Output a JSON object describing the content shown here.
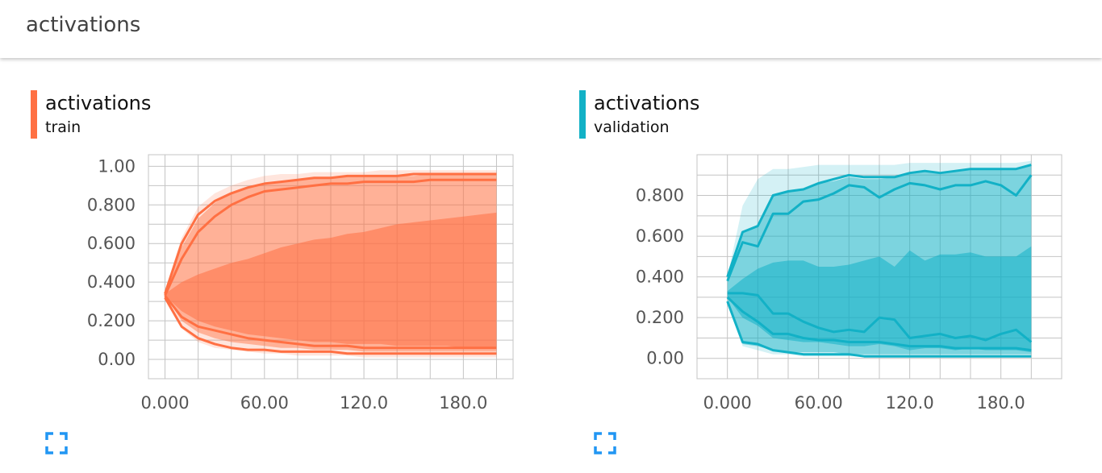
{
  "header": {
    "title": "activations"
  },
  "colors": {
    "train": "#ff7043",
    "validation": "#12b1c6"
  },
  "cards": [
    {
      "title": "activations",
      "subtitle": "train",
      "color": "#ff7043",
      "expand_icon": "fullscreen-icon",
      "chart_data": {
        "type": "area",
        "title": "activations",
        "subtitle": "train",
        "xlim": [
          -10,
          210
        ],
        "ylim": [
          -0.1,
          1.06
        ],
        "xticks": [
          0,
          60,
          120,
          180
        ],
        "xtick_labels": [
          "0.000",
          "60.00",
          "120.0",
          "180.0"
        ],
        "yticks": [
          0,
          0.2,
          0.4,
          0.6,
          0.8,
          1.0
        ],
        "ytick_labels": [
          "0.00",
          "0.200",
          "0.400",
          "0.600",
          "0.800",
          "1.00"
        ],
        "grid": true,
        "x": [
          0,
          10,
          20,
          30,
          40,
          50,
          60,
          70,
          80,
          90,
          100,
          110,
          120,
          130,
          140,
          150,
          160,
          170,
          180,
          190,
          200
        ],
        "bands": [
          {
            "name": "outer",
            "lower": [
              0.33,
              0.16,
              0.09,
              0.06,
              0.05,
              0.04,
              0.03,
              0.03,
              0.02,
              0.02,
              0.02,
              0.02,
              0.01,
              0.01,
              0.01,
              0.01,
              0.01,
              0.01,
              0.01,
              0.01,
              0.01
            ],
            "upper": [
              0.36,
              0.63,
              0.79,
              0.86,
              0.9,
              0.93,
              0.95,
              0.96,
              0.96,
              0.97,
              0.97,
              0.97,
              0.97,
              0.98,
              0.98,
              0.98,
              0.98,
              0.98,
              0.98,
              0.98,
              0.98
            ]
          },
          {
            "name": "mid",
            "lower": [
              0.33,
              0.2,
              0.14,
              0.11,
              0.09,
              0.08,
              0.07,
              0.06,
              0.06,
              0.05,
              0.05,
              0.05,
              0.04,
              0.04,
              0.04,
              0.04,
              0.04,
              0.04,
              0.04,
              0.04,
              0.04
            ],
            "upper": [
              0.35,
              0.58,
              0.73,
              0.81,
              0.86,
              0.89,
              0.91,
              0.92,
              0.93,
              0.94,
              0.94,
              0.95,
              0.95,
              0.95,
              0.95,
              0.95,
              0.96,
              0.96,
              0.96,
              0.96,
              0.96
            ]
          },
          {
            "name": "inner",
            "lower": [
              0.33,
              0.25,
              0.2,
              0.17,
              0.15,
              0.13,
              0.12,
              0.11,
              0.1,
              0.09,
              0.09,
              0.08,
              0.08,
              0.08,
              0.07,
              0.07,
              0.07,
              0.07,
              0.06,
              0.06,
              0.06
            ],
            "upper": [
              0.34,
              0.4,
              0.44,
              0.47,
              0.5,
              0.52,
              0.55,
              0.58,
              0.6,
              0.62,
              0.63,
              0.65,
              0.66,
              0.68,
              0.7,
              0.71,
              0.72,
              0.73,
              0.74,
              0.75,
              0.76
            ]
          }
        ],
        "lines": [
          {
            "values": [
              0.34,
              0.6,
              0.75,
              0.82,
              0.86,
              0.89,
              0.91,
              0.92,
              0.93,
              0.94,
              0.94,
              0.95,
              0.95,
              0.95,
              0.95,
              0.96,
              0.96,
              0.96,
              0.96,
              0.96,
              0.96
            ]
          },
          {
            "values": [
              0.33,
              0.52,
              0.66,
              0.74,
              0.8,
              0.84,
              0.87,
              0.88,
              0.89,
              0.9,
              0.91,
              0.91,
              0.92,
              0.92,
              0.92,
              0.92,
              0.93,
              0.93,
              0.93,
              0.93,
              0.93
            ]
          },
          {
            "values": [
              0.33,
              0.22,
              0.17,
              0.15,
              0.13,
              0.11,
              0.1,
              0.09,
              0.08,
              0.07,
              0.07,
              0.07,
              0.06,
              0.06,
              0.06,
              0.06,
              0.06,
              0.06,
              0.06,
              0.06,
              0.06
            ]
          },
          {
            "values": [
              0.32,
              0.17,
              0.11,
              0.08,
              0.06,
              0.05,
              0.05,
              0.04,
              0.04,
              0.04,
              0.04,
              0.03,
              0.03,
              0.03,
              0.03,
              0.03,
              0.03,
              0.03,
              0.03,
              0.03,
              0.03
            ]
          }
        ]
      }
    },
    {
      "title": "activations",
      "subtitle": "validation",
      "color": "#12b1c6",
      "expand_icon": "fullscreen-icon",
      "chart_data": {
        "type": "area",
        "title": "activations",
        "subtitle": "validation",
        "xlim": [
          -20,
          220
        ],
        "ylim": [
          -0.1,
          1.0
        ],
        "xticks": [
          0,
          60,
          120,
          180
        ],
        "xtick_labels": [
          "0.000",
          "60.00",
          "120.0",
          "180.0"
        ],
        "yticks": [
          0,
          0.2,
          0.4,
          0.6,
          0.8
        ],
        "ytick_labels": [
          "0.00",
          "0.200",
          "0.400",
          "0.600",
          "0.800"
        ],
        "grid": true,
        "x": [
          0,
          10,
          20,
          30,
          40,
          50,
          60,
          70,
          80,
          90,
          100,
          110,
          120,
          130,
          140,
          150,
          160,
          170,
          180,
          190,
          200
        ],
        "bands": [
          {
            "name": "outer",
            "lower": [
              0.28,
              0.06,
              0.04,
              0.02,
              0.02,
              0.01,
              0.01,
              0.01,
              0.01,
              0.01,
              0.01,
              0.01,
              0.01,
              0.01,
              0.01,
              0.01,
              0.01,
              0.01,
              0.01,
              0.01,
              0.01
            ],
            "upper": [
              0.4,
              0.75,
              0.88,
              0.93,
              0.93,
              0.94,
              0.95,
              0.95,
              0.95,
              0.95,
              0.95,
              0.95,
              0.96,
              0.96,
              0.96,
              0.96,
              0.96,
              0.96,
              0.96,
              0.96,
              0.97
            ]
          },
          {
            "name": "mid",
            "lower": [
              0.29,
              0.07,
              0.06,
              0.04,
              0.03,
              0.03,
              0.03,
              0.03,
              0.02,
              0.02,
              0.02,
              0.02,
              0.02,
              0.02,
              0.02,
              0.02,
              0.02,
              0.02,
              0.02,
              0.02,
              0.02
            ],
            "upper": [
              0.4,
              0.62,
              0.65,
              0.8,
              0.82,
              0.83,
              0.86,
              0.87,
              0.89,
              0.88,
              0.88,
              0.89,
              0.91,
              0.92,
              0.91,
              0.92,
              0.93,
              0.93,
              0.93,
              0.93,
              0.95
            ]
          },
          {
            "name": "inner",
            "lower": [
              0.3,
              0.2,
              0.16,
              0.1,
              0.09,
              0.08,
              0.08,
              0.07,
              0.06,
              0.06,
              0.07,
              0.06,
              0.04,
              0.05,
              0.05,
              0.04,
              0.05,
              0.04,
              0.04,
              0.04,
              0.03
            ],
            "upper": [
              0.33,
              0.39,
              0.44,
              0.47,
              0.48,
              0.48,
              0.45,
              0.45,
              0.46,
              0.48,
              0.5,
              0.45,
              0.53,
              0.48,
              0.51,
              0.51,
              0.52,
              0.5,
              0.5,
              0.5,
              0.55
            ]
          }
        ],
        "lines": [
          {
            "values": [
              0.4,
              0.62,
              0.65,
              0.8,
              0.82,
              0.83,
              0.86,
              0.88,
              0.9,
              0.89,
              0.89,
              0.89,
              0.91,
              0.92,
              0.91,
              0.92,
              0.93,
              0.93,
              0.93,
              0.93,
              0.95
            ]
          },
          {
            "values": [
              0.38,
              0.57,
              0.55,
              0.71,
              0.71,
              0.77,
              0.78,
              0.81,
              0.85,
              0.84,
              0.79,
              0.83,
              0.86,
              0.85,
              0.83,
              0.85,
              0.85,
              0.87,
              0.85,
              0.8,
              0.9
            ]
          },
          {
            "values": [
              0.32,
              0.32,
              0.31,
              0.22,
              0.22,
              0.18,
              0.15,
              0.13,
              0.14,
              0.13,
              0.2,
              0.19,
              0.1,
              0.11,
              0.12,
              0.1,
              0.11,
              0.09,
              0.12,
              0.14,
              0.08
            ]
          },
          {
            "values": [
              0.3,
              0.23,
              0.18,
              0.12,
              0.12,
              0.1,
              0.09,
              0.09,
              0.08,
              0.08,
              0.08,
              0.07,
              0.06,
              0.06,
              0.06,
              0.05,
              0.05,
              0.05,
              0.05,
              0.05,
              0.04
            ]
          },
          {
            "values": [
              0.28,
              0.08,
              0.07,
              0.04,
              0.03,
              0.02,
              0.02,
              0.02,
              0.02,
              0.01,
              0.01,
              0.01,
              0.01,
              0.01,
              0.01,
              0.01,
              0.01,
              0.01,
              0.01,
              0.01,
              0.01
            ]
          }
        ]
      }
    }
  ]
}
